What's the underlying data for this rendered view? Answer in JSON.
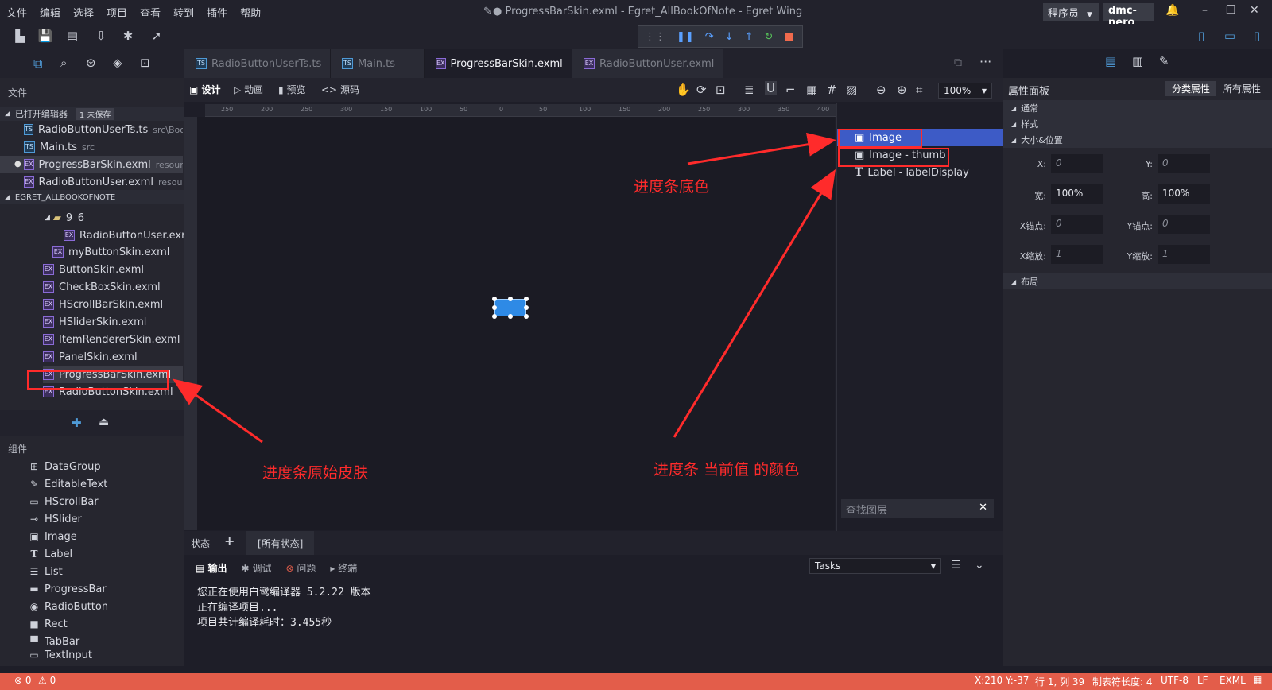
{
  "menu": [
    "文件",
    "编辑",
    "选择",
    "项目",
    "查看",
    "转到",
    "插件",
    "帮助"
  ],
  "window": {
    "title": "● ProgressBarSkin.exml - Egret_AllBookOfNote - Egret Wing",
    "role": "程序员",
    "user": "dmc-nero"
  },
  "explorer": {
    "title": "文件",
    "open_editors_label": "已打开编辑器",
    "unsaved_badge": "1 未保存",
    "open_files": [
      {
        "name": "RadioButtonUserTs.ts",
        "path": "src\\Boo..."
      },
      {
        "name": "Main.ts",
        "path": "src"
      },
      {
        "name": "ProgressBarSkin.exml",
        "path": "resourc..."
      },
      {
        "name": "RadioButtonUser.exml",
        "path": "resourc..."
      }
    ],
    "project_label": "EGRET_ALLBOOKOFNOTE",
    "folder": "9_6",
    "files": [
      "RadioButtonUser.exml",
      "myButtonSkin.exml",
      "ButtonSkin.exml",
      "CheckBoxSkin.exml",
      "HScrollBarSkin.exml",
      "HSliderSkin.exml",
      "ItemRendererSkin.exml",
      "PanelSkin.exml",
      "ProgressBarSkin.exml",
      "RadioButtonSkin.exml"
    ]
  },
  "components": {
    "title": "组件",
    "items": [
      "DataGroup",
      "EditableText",
      "HScrollBar",
      "HSlider",
      "Image",
      "Label",
      "List",
      "ProgressBar",
      "RadioButton",
      "Rect",
      "TabBar",
      "TextInput"
    ]
  },
  "tabs": [
    "RadioButtonUserTs.ts",
    "Main.ts",
    "ProgressBarSkin.exml",
    "RadioButtonUser.exml"
  ],
  "design_modes": [
    "设计",
    "动画",
    "预览",
    "源码"
  ],
  "zoom": "100%",
  "ruler_ticks": [
    "250",
    "200",
    "250",
    "300",
    "150",
    "100",
    "50",
    "0",
    "50",
    "100",
    "150",
    "200",
    "250",
    "300",
    "350",
    "400"
  ],
  "layers": {
    "items": [
      "Image",
      "Image - thumb",
      "Label - labelDisplay"
    ],
    "find_placeholder": "查找图层"
  },
  "properties": {
    "title": "属性面板",
    "tab_categorized": "分类属性",
    "tab_all": "所有属性",
    "sections": {
      "common": "通常",
      "style": "样式",
      "size_pos": "大小&位置",
      "layout": "布局"
    },
    "fields": {
      "x_label": "X:",
      "x_val": "0",
      "y_label": "Y:",
      "y_val": "0",
      "w_label": "宽:",
      "w_val": "100%",
      "h_label": "高:",
      "h_val": "100%",
      "ax_label": "X锚点:",
      "ax_val": "0",
      "ay_label": "Y锚点:",
      "ay_val": "0",
      "sx_label": "X缩放:",
      "sx_val": "1",
      "sy_label": "Y缩放:",
      "sy_val": "1"
    }
  },
  "state_bar": {
    "label": "状态",
    "add": "+",
    "all_states": "[所有状态]"
  },
  "output": {
    "tabs": [
      "输出",
      "调试",
      "问题",
      "终端"
    ],
    "task_select": "Tasks",
    "lines": [
      "您正在使用白鹭编译器 5.2.22 版本",
      "正在编译项目...",
      "项目共计编译耗时：3.455秒"
    ]
  },
  "status": {
    "errors": "0",
    "warnings": "0",
    "cursor": "X:210 Y:-37",
    "line_col": "行 1, 列 39",
    "tab_size": "制表符长度: 4",
    "encoding": "UTF-8",
    "eol": "LF",
    "lang": "EXML"
  },
  "annotations": {
    "base_color": "进度条底色",
    "original_skin": "进度条原始皮肤",
    "current_value_color": "进度条 当前值 的颜色"
  },
  "colors": {
    "accent": "#3d5bc6",
    "status": "#e35d4a",
    "annotation": "#ff2b2b"
  }
}
